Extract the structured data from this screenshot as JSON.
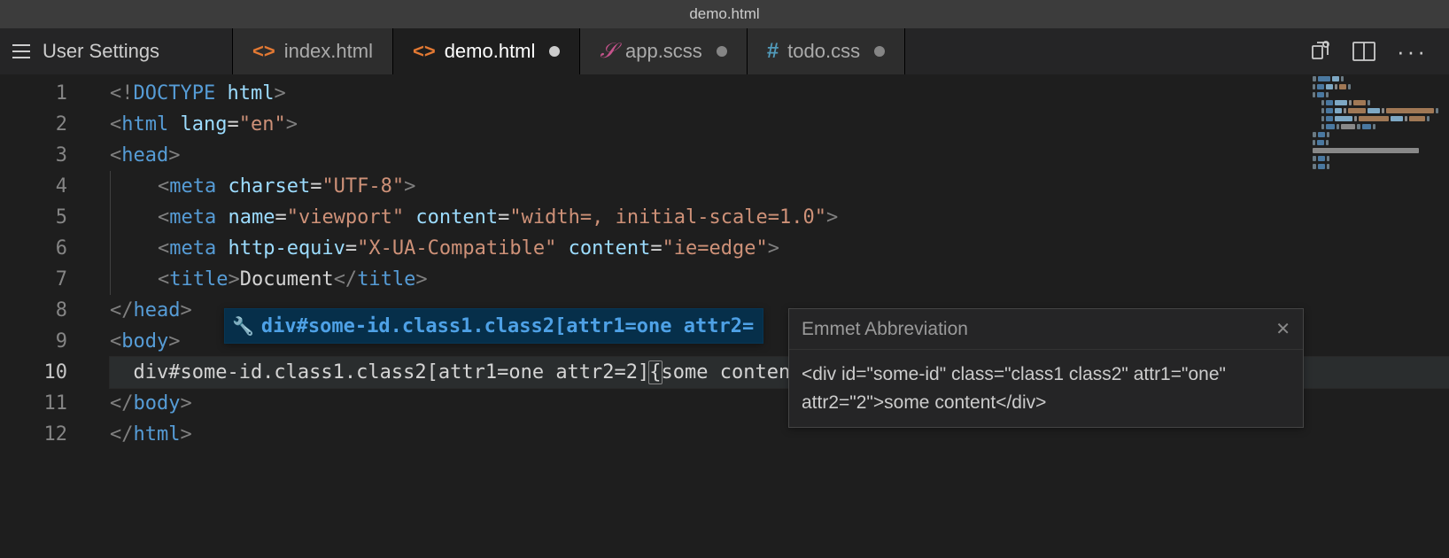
{
  "titlebar": {
    "title": "demo.html"
  },
  "tabs": {
    "settings_label": "User Settings",
    "items": [
      {
        "label": "index.html",
        "icon": "code",
        "icon_color": "#e37933",
        "active": false,
        "dirty": false
      },
      {
        "label": "demo.html",
        "icon": "code",
        "icon_color": "#e37933",
        "active": true,
        "dirty": true
      },
      {
        "label": "app.scss",
        "icon": "scss",
        "icon_color": "#c6538c",
        "active": false,
        "dirty": true
      },
      {
        "label": "todo.css",
        "icon": "hash",
        "icon_color": "#519aba",
        "active": false,
        "dirty": true
      }
    ]
  },
  "editor": {
    "current_line": 10,
    "lines": [
      {
        "n": 1,
        "indent": 0,
        "tokens": [
          [
            "p",
            "<!"
          ],
          [
            "t",
            "DOCTYPE"
          ],
          [
            "w",
            " "
          ],
          [
            "a",
            "html"
          ],
          [
            "p",
            ">"
          ]
        ]
      },
      {
        "n": 2,
        "indent": 0,
        "tokens": [
          [
            "p",
            "<"
          ],
          [
            "t",
            "html"
          ],
          [
            "w",
            " "
          ],
          [
            "a",
            "lang"
          ],
          [
            "w",
            "="
          ],
          [
            "s",
            "\"en\""
          ],
          [
            "p",
            ">"
          ]
        ]
      },
      {
        "n": 3,
        "indent": 0,
        "tokens": [
          [
            "p",
            "<"
          ],
          [
            "t",
            "head"
          ],
          [
            "p",
            ">"
          ]
        ]
      },
      {
        "n": 4,
        "indent": 1,
        "tokens": [
          [
            "p",
            "<"
          ],
          [
            "t",
            "meta"
          ],
          [
            "w",
            " "
          ],
          [
            "a",
            "charset"
          ],
          [
            "w",
            "="
          ],
          [
            "s",
            "\"UTF-8\""
          ],
          [
            "p",
            ">"
          ]
        ]
      },
      {
        "n": 5,
        "indent": 1,
        "tokens": [
          [
            "p",
            "<"
          ],
          [
            "t",
            "meta"
          ],
          [
            "w",
            " "
          ],
          [
            "a",
            "name"
          ],
          [
            "w",
            "="
          ],
          [
            "s",
            "\"viewport\""
          ],
          [
            "w",
            " "
          ],
          [
            "a",
            "content"
          ],
          [
            "w",
            "="
          ],
          [
            "s",
            "\"width=, initial-scale=1.0\""
          ],
          [
            "p",
            ">"
          ]
        ]
      },
      {
        "n": 6,
        "indent": 1,
        "tokens": [
          [
            "p",
            "<"
          ],
          [
            "t",
            "meta"
          ],
          [
            "w",
            " "
          ],
          [
            "a",
            "http-equiv"
          ],
          [
            "w",
            "="
          ],
          [
            "s",
            "\"X-UA-Compatible\""
          ],
          [
            "w",
            " "
          ],
          [
            "a",
            "content"
          ],
          [
            "w",
            "="
          ],
          [
            "s",
            "\"ie=edge\""
          ],
          [
            "p",
            ">"
          ]
        ]
      },
      {
        "n": 7,
        "indent": 1,
        "tokens": [
          [
            "p",
            "<"
          ],
          [
            "t",
            "title"
          ],
          [
            "p",
            ">"
          ],
          [
            "w",
            "Document"
          ],
          [
            "p",
            "</"
          ],
          [
            "t",
            "title"
          ],
          [
            "p",
            ">"
          ]
        ]
      },
      {
        "n": 8,
        "indent": 0,
        "tokens": [
          [
            "p",
            "</"
          ],
          [
            "t",
            "head"
          ],
          [
            "p",
            ">"
          ]
        ]
      },
      {
        "n": 9,
        "indent": 0,
        "tokens": [
          [
            "p",
            "<"
          ],
          [
            "t",
            "body"
          ],
          [
            "p",
            ">"
          ]
        ]
      },
      {
        "n": 10,
        "indent": 0,
        "current": true,
        "raw10": true
      },
      {
        "n": 11,
        "indent": 0,
        "tokens": [
          [
            "p",
            "</"
          ],
          [
            "t",
            "body"
          ],
          [
            "p",
            ">"
          ]
        ]
      },
      {
        "n": 12,
        "indent": 0,
        "tokens": [
          [
            "p",
            "</"
          ],
          [
            "t",
            "html"
          ],
          [
            "p",
            ">"
          ]
        ]
      }
    ],
    "line10": {
      "prefix": "  div#some-id.class1.class2[attr1=one attr2=2]",
      "open_brace": "{",
      "content": "some content",
      "close_brace": "}"
    }
  },
  "suggest": {
    "icon": "wrench-icon",
    "text": "div#some-id.class1.class2[attr1=one attr2="
  },
  "hover": {
    "title": "Emmet Abbreviation",
    "body": "<div id=\"some-id\" class=\"class1 class2\" attr1=\"one\" attr2=\"2\">some content</div>"
  }
}
